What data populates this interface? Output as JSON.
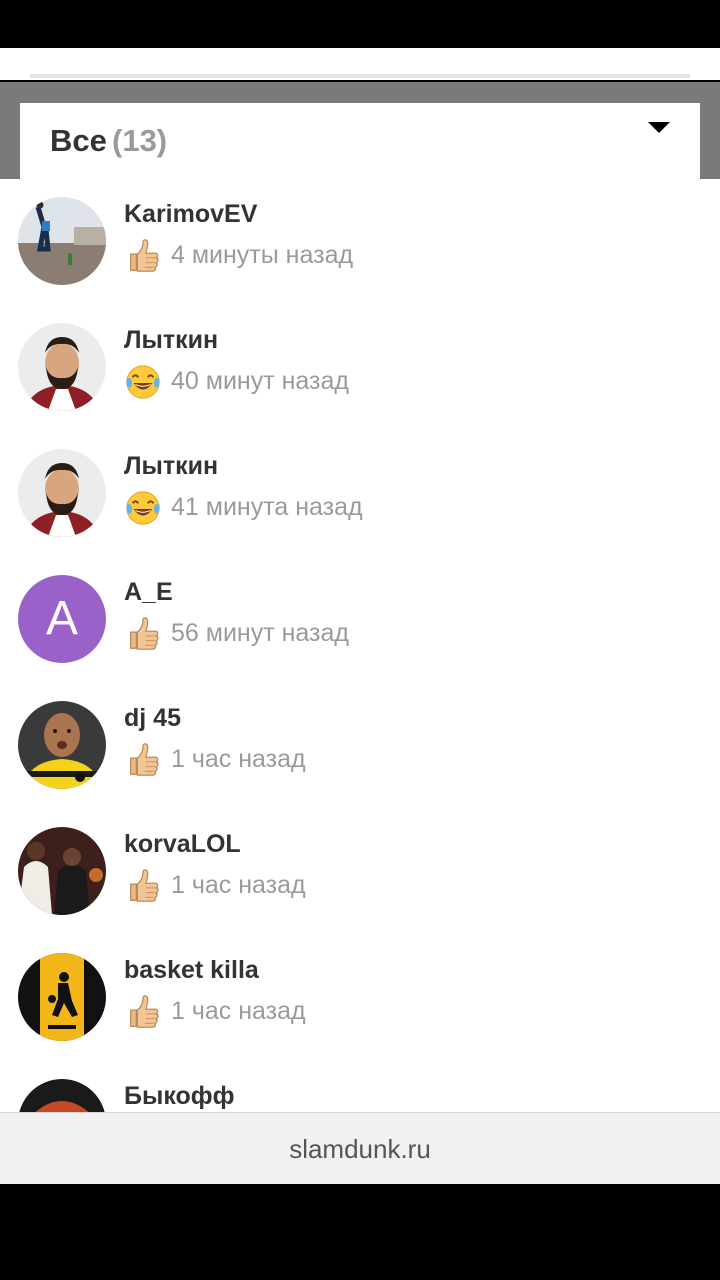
{
  "filter": {
    "label": "Все",
    "count": "(13)"
  },
  "reactions": [
    {
      "name": "KarimovEV",
      "reaction_icon": "thumbs-up-icon",
      "time": "4 минуты назад"
    },
    {
      "name": "Лыткин",
      "reaction_icon": "laughing-crying-icon",
      "time": "40 минут назад"
    },
    {
      "name": "Лыткин",
      "reaction_icon": "laughing-crying-icon",
      "time": "41 минута назад"
    },
    {
      "name": "A_E",
      "reaction_icon": "thumbs-up-icon",
      "time": "56 минут назад",
      "avatar_letter": "A",
      "avatar_color": "#9a62c8"
    },
    {
      "name": "dj 45",
      "reaction_icon": "thumbs-up-icon",
      "time": "1 час назад"
    },
    {
      "name": "korvaLOL",
      "reaction_icon": "thumbs-up-icon",
      "time": "1 час назад"
    },
    {
      "name": "basket killa",
      "reaction_icon": "thumbs-up-icon",
      "time": "1 час назад"
    },
    {
      "name": "Быкофф"
    }
  ],
  "footer": {
    "site": "slamdunk.ru"
  },
  "colors": {
    "overlay": "#7a7a7a",
    "name_text": "#333333",
    "time_text": "#9a9a9a",
    "footer_bg": "#f1f1f1"
  }
}
